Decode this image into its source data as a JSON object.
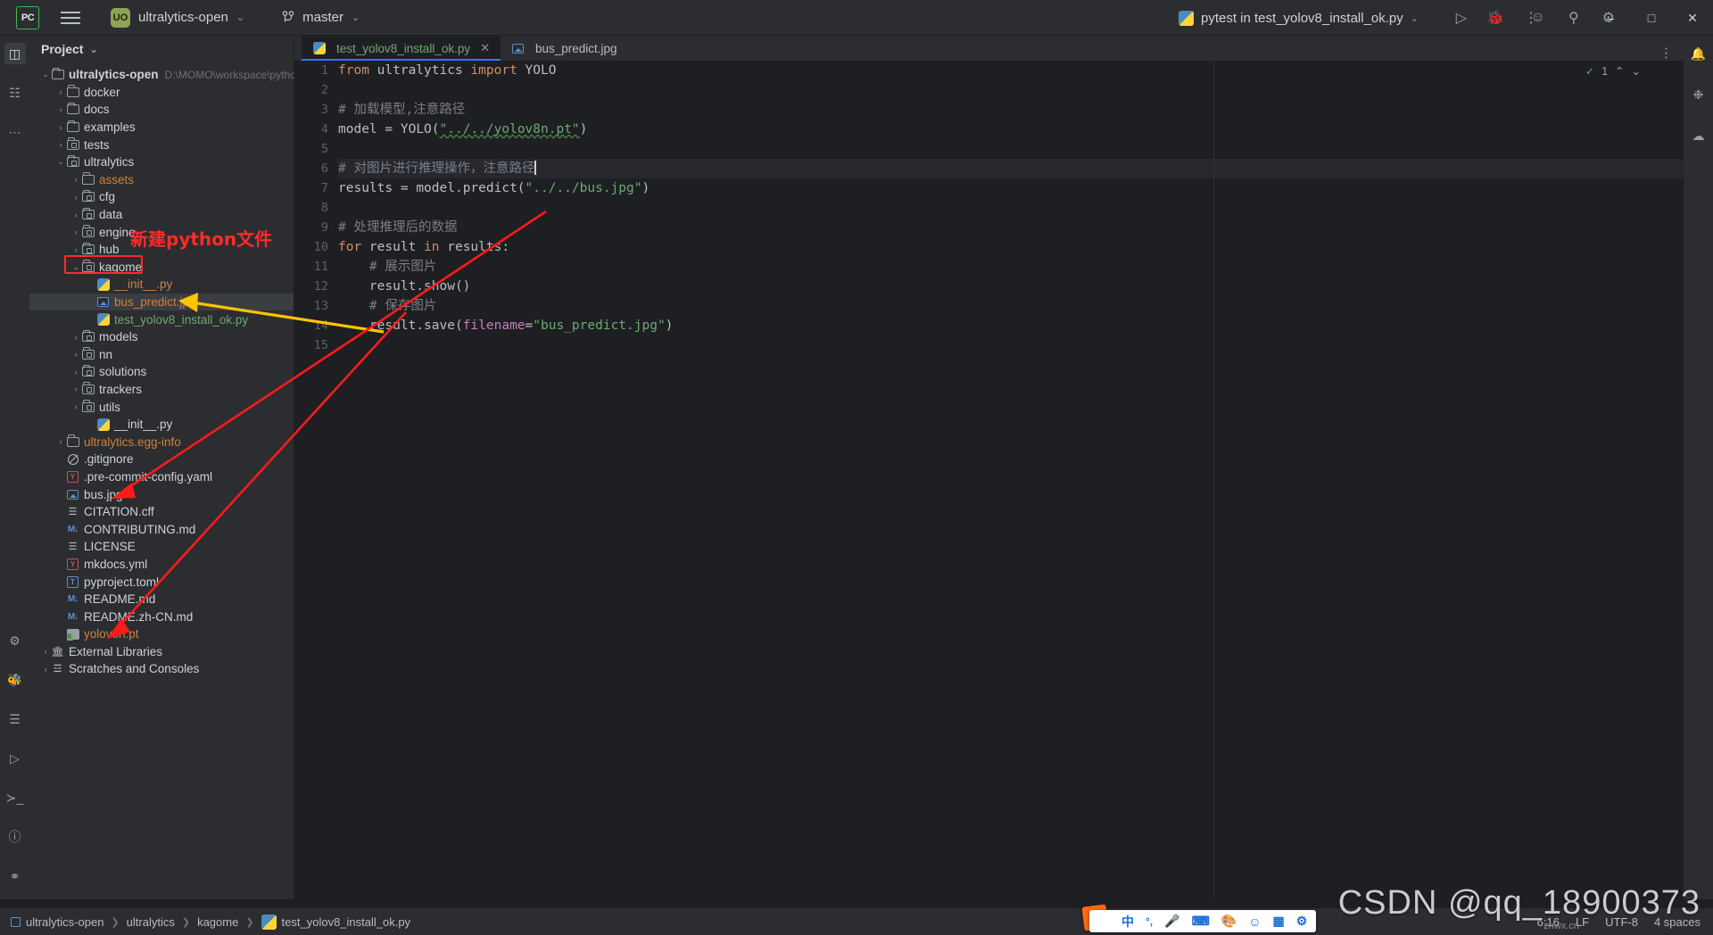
{
  "titlebar": {
    "logo": "PC",
    "project_badge": "UO",
    "project_name": "ultralytics-open",
    "branch": "master",
    "run_config": "pytest in test_yolov8_install_ok.py",
    "icons": [
      "hamburger-icon",
      "chevron-down-icon",
      "branch-icon",
      "run-icon",
      "debug-icon",
      "more-icon",
      "account-icon",
      "search-icon",
      "settings-icon"
    ],
    "window_controls": [
      "minimize",
      "maximize",
      "close"
    ]
  },
  "left_rail": {
    "items": [
      "project-icon",
      "commit-icon",
      "more-tool-windows-icon"
    ],
    "bottom_items": [
      "python-console-icon",
      "debug-icon",
      "services-icon",
      "run-icon",
      "terminal-icon",
      "problems-icon",
      "version-control-icon"
    ]
  },
  "right_rail": {
    "items": [
      "notifications-icon",
      "ai-assistant-icon",
      "database-icon"
    ]
  },
  "panel": {
    "title": "Project",
    "tree": [
      {
        "depth": 0,
        "arrow": "down",
        "icon": "folder",
        "label": "ultralytics-open",
        "bold": true,
        "path": "D:\\MOMO\\workspace\\python\\ultral",
        "color": "white"
      },
      {
        "depth": 1,
        "arrow": "right",
        "icon": "folder",
        "label": "docker",
        "color": "white"
      },
      {
        "depth": 1,
        "arrow": "right",
        "icon": "folder",
        "label": "docs",
        "color": "white"
      },
      {
        "depth": 1,
        "arrow": "right",
        "icon": "folder",
        "label": "examples",
        "color": "white"
      },
      {
        "depth": 1,
        "arrow": "right",
        "icon": "folder-source",
        "label": "tests",
        "color": "white"
      },
      {
        "depth": 1,
        "arrow": "down",
        "icon": "folder-source",
        "label": "ultralytics",
        "color": "white"
      },
      {
        "depth": 2,
        "arrow": "right",
        "icon": "folder",
        "label": "assets",
        "color": "orange"
      },
      {
        "depth": 2,
        "arrow": "right",
        "icon": "folder-source",
        "label": "cfg",
        "color": "white"
      },
      {
        "depth": 2,
        "arrow": "right",
        "icon": "folder-source",
        "label": "data",
        "color": "white"
      },
      {
        "depth": 2,
        "arrow": "right",
        "icon": "folder-source",
        "label": "engine",
        "color": "white"
      },
      {
        "depth": 2,
        "arrow": "right",
        "icon": "folder-source",
        "label": "hub",
        "color": "white"
      },
      {
        "depth": 2,
        "arrow": "down",
        "icon": "folder-source",
        "label": "kagome",
        "color": "white",
        "boxed": true
      },
      {
        "depth": 3,
        "arrow": "none",
        "icon": "python",
        "label": "__init__.py",
        "color": "orange"
      },
      {
        "depth": 3,
        "arrow": "none",
        "icon": "image",
        "label": "bus_predict.jpg",
        "color": "orange",
        "selected": true
      },
      {
        "depth": 3,
        "arrow": "none",
        "icon": "python",
        "label": "test_yolov8_install_ok.py",
        "color": "green"
      },
      {
        "depth": 2,
        "arrow": "right",
        "icon": "folder-source",
        "label": "models",
        "color": "white"
      },
      {
        "depth": 2,
        "arrow": "right",
        "icon": "folder-source",
        "label": "nn",
        "color": "white"
      },
      {
        "depth": 2,
        "arrow": "right",
        "icon": "folder-source",
        "label": "solutions",
        "color": "white"
      },
      {
        "depth": 2,
        "arrow": "right",
        "icon": "folder-source",
        "label": "trackers",
        "color": "white"
      },
      {
        "depth": 2,
        "arrow": "right",
        "icon": "folder-source",
        "label": "utils",
        "color": "white"
      },
      {
        "depth": 3,
        "arrow": "none",
        "icon": "python",
        "label": "__init__.py",
        "color": "white"
      },
      {
        "depth": 1,
        "arrow": "right",
        "icon": "folder",
        "label": "ultralytics.egg-info",
        "color": "orange"
      },
      {
        "depth": 1,
        "arrow": "none",
        "icon": "gitignore",
        "label": ".gitignore",
        "color": "white"
      },
      {
        "depth": 1,
        "arrow": "none",
        "icon": "yaml",
        "label": ".pre-commit-config.yaml",
        "color": "white"
      },
      {
        "depth": 1,
        "arrow": "none",
        "icon": "image",
        "label": "bus.jpg",
        "color": "white"
      },
      {
        "depth": 1,
        "arrow": "none",
        "icon": "text",
        "label": "CITATION.cff",
        "color": "white"
      },
      {
        "depth": 1,
        "arrow": "none",
        "icon": "markdown",
        "label": "CONTRIBUTING.md",
        "color": "white"
      },
      {
        "depth": 1,
        "arrow": "none",
        "icon": "text",
        "label": "LICENSE",
        "color": "white"
      },
      {
        "depth": 1,
        "arrow": "none",
        "icon": "yaml",
        "label": "mkdocs.yml",
        "color": "white"
      },
      {
        "depth": 1,
        "arrow": "none",
        "icon": "toml",
        "label": "pyproject.toml",
        "color": "white"
      },
      {
        "depth": 1,
        "arrow": "none",
        "icon": "markdown",
        "label": "README.md",
        "color": "white"
      },
      {
        "depth": 1,
        "arrow": "none",
        "icon": "markdown",
        "label": "README.zh-CN.md",
        "color": "white"
      },
      {
        "depth": 1,
        "arrow": "none",
        "icon": "pt-model",
        "label": "yolov8n.pt",
        "color": "orange"
      },
      {
        "depth": 0,
        "arrow": "right",
        "icon": "library",
        "label": "External Libraries",
        "color": "white"
      },
      {
        "depth": 0,
        "arrow": "right",
        "icon": "scratch",
        "label": "Scratches and Consoles",
        "color": "white"
      }
    ]
  },
  "editor": {
    "tabs": [
      {
        "label": "test_yolov8_install_ok.py",
        "icon": "python",
        "active": true,
        "closable": true
      },
      {
        "label": "bus_predict.jpg",
        "icon": "image",
        "active": false,
        "closable": false
      }
    ],
    "inspection": {
      "count": "1",
      "status": "ok"
    },
    "lines": [
      {
        "n": "1",
        "tokens": [
          {
            "t": "from ",
            "c": "kw"
          },
          {
            "t": "ultralytics ",
            "c": "ident"
          },
          {
            "t": "import ",
            "c": "kw"
          },
          {
            "t": "YOLO",
            "c": "ident"
          }
        ]
      },
      {
        "n": "2",
        "tokens": []
      },
      {
        "n": "3",
        "tokens": [
          {
            "t": "# 加载模型,注意路径",
            "c": "cm"
          }
        ]
      },
      {
        "n": "4",
        "tokens": [
          {
            "t": "model ",
            "c": "ident"
          },
          {
            "t": "= ",
            "c": "ident"
          },
          {
            "t": "YOLO(",
            "c": "ident"
          },
          {
            "t": "\"../../yolov8n.pt\"",
            "c": "str"
          },
          {
            "t": ")",
            "c": "ident"
          }
        ]
      },
      {
        "n": "5",
        "tokens": []
      },
      {
        "n": "6",
        "current": true,
        "tokens": [
          {
            "t": "# 对图片进行推理操作，注意路径",
            "c": "cm"
          }
        ]
      },
      {
        "n": "7",
        "tokens": [
          {
            "t": "results ",
            "c": "ident"
          },
          {
            "t": "= ",
            "c": "ident"
          },
          {
            "t": "model.predict(",
            "c": "ident"
          },
          {
            "t": "\"../../bus.jpg\"",
            "c": "str"
          },
          {
            "t": ")",
            "c": "ident"
          }
        ]
      },
      {
        "n": "8",
        "tokens": []
      },
      {
        "n": "9",
        "tokens": [
          {
            "t": "# 处理推理后的数据",
            "c": "cm"
          }
        ]
      },
      {
        "n": "10",
        "tokens": [
          {
            "t": "for ",
            "c": "kw"
          },
          {
            "t": "result ",
            "c": "ident"
          },
          {
            "t": "in ",
            "c": "kw"
          },
          {
            "t": "results:",
            "c": "ident"
          }
        ]
      },
      {
        "n": "11",
        "tokens": [
          {
            "t": "    # 展示图片",
            "c": "cm"
          }
        ]
      },
      {
        "n": "12",
        "tokens": [
          {
            "t": "    result.show()",
            "c": "ident"
          }
        ]
      },
      {
        "n": "13",
        "tokens": [
          {
            "t": "    # 保存图片",
            "c": "cm"
          }
        ]
      },
      {
        "n": "14",
        "tokens": [
          {
            "t": "    result.save(",
            "c": "ident"
          },
          {
            "t": "filename",
            "c": "param"
          },
          {
            "t": "=",
            "c": "ident"
          },
          {
            "t": "\"bus_predict.jpg\"",
            "c": "str"
          },
          {
            "t": ")",
            "c": "ident"
          }
        ]
      },
      {
        "n": "15",
        "tokens": []
      }
    ]
  },
  "status_bar": {
    "breadcrumb": [
      "ultralytics-open",
      "ultralytics",
      "kagome",
      "test_yolov8_install_ok.py"
    ],
    "right": [
      "6:16",
      "LF",
      "UTF-8",
      "4 spaces"
    ]
  },
  "ime": {
    "brand": "S",
    "items": [
      "中",
      "°,",
      "mic-icon",
      "keyboard-icon",
      "palette-icon",
      "emoji-icon",
      "apps-icon",
      "tools-icon"
    ]
  },
  "annotations": {
    "note_new_python_file": "新建python文件",
    "red_box_target": "kagome",
    "arrows": [
      {
        "color": "#ffc400",
        "from": "code-line-14",
        "to": "bus_predict.jpg"
      },
      {
        "color": "#ff1a1a",
        "from": "code-line-7",
        "to": "bus.jpg"
      },
      {
        "color": "#ff1a1a",
        "from": "code-line-4",
        "to": "yolov8n.pt"
      }
    ]
  },
  "watermark": {
    "text": "CSDN @qq_18900373",
    "small": "zhwx.cn"
  },
  "colors": {
    "accent": "#3574f0",
    "annotation_red": "#ff1a1a",
    "annotation_yellow": "#ffc400",
    "panel_bg": "#2b2d30",
    "editor_bg": "#1e1f22"
  }
}
